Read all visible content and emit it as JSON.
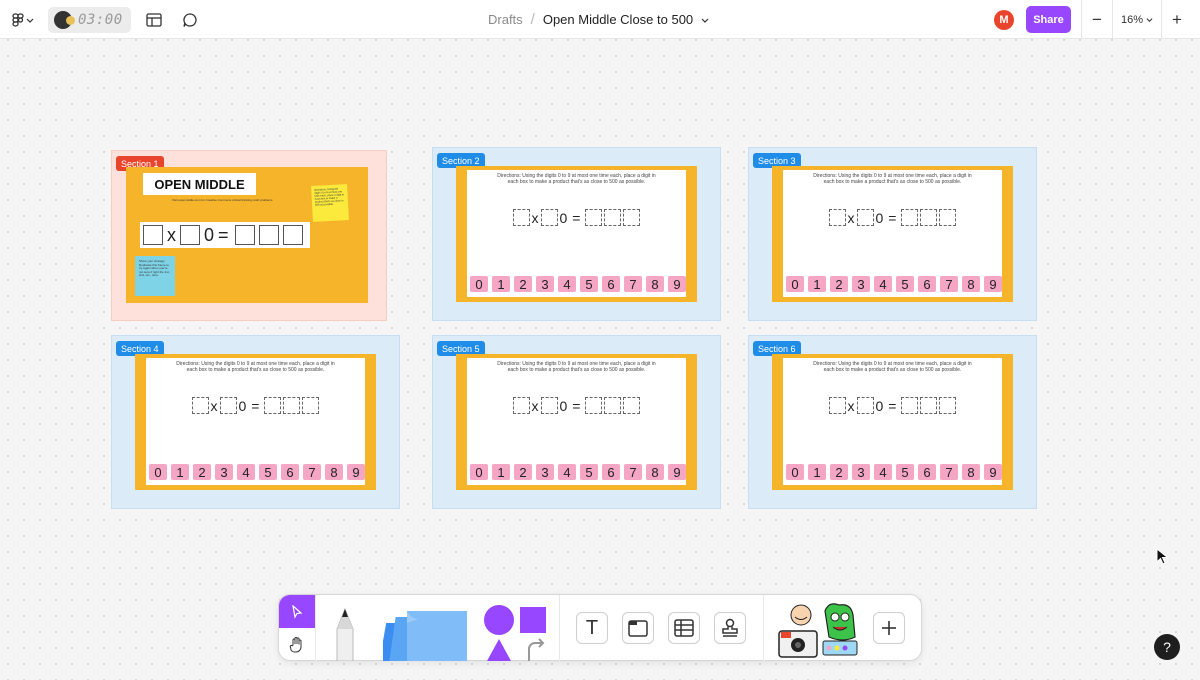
{
  "topbar": {
    "timer": "03:00",
    "breadcrumb_parent": "Drafts",
    "breadcrumb_sep": "/",
    "file_title": "Open Middle Close to 500",
    "avatar_initial": "M",
    "share_label": "Share",
    "zoom_minus": "−",
    "zoom_value": "16%",
    "zoom_plus": "+"
  },
  "colors": {
    "accent": "#9747ff",
    "section_pink": "#fde1da",
    "section_blue": "#dbebf8",
    "slide_orange": "#f6b42a",
    "digit_pink": "#f4a6c4"
  },
  "sections": [
    {
      "label": "Section 1"
    },
    {
      "label": "Section 2"
    },
    {
      "label": "Section 3"
    },
    {
      "label": "Section 4"
    },
    {
      "label": "Section 5"
    },
    {
      "label": "Section 6"
    }
  ],
  "slide": {
    "directions": "Directions: Using the digits 0 to 9 at most one time each, place a digit in each box to make a product that's as close to 500 as possible.",
    "times": "x",
    "zero": "0",
    "equals": "=",
    "digits": [
      "0",
      "1",
      "2",
      "3",
      "4",
      "5",
      "6",
      "7",
      "8",
      "9"
    ]
  },
  "section1": {
    "title": "OPEN MIDDLE",
    "subtitle": "Visit openmiddle.com for Creative Commons critical thinking math problems",
    "sticky_yellow": "Directions: Using the digits 0 to 9 at most one time each, place a digit in each box to make a product that's as close to 500 as possible.",
    "sticky_blue": "Show your strategy. Duplicate this frame to try again when you're not sure if right the 1st, 2nd, etc., time."
  },
  "toolbar": {
    "text_tool": "T",
    "icons": [
      "cursor-icon",
      "hand-icon",
      "pen-icon",
      "sticky-note-icon",
      "shapes-icon",
      "text-icon",
      "section-icon",
      "table-icon",
      "stamp-icon",
      "stickers-icon",
      "plus-icon"
    ]
  },
  "help_label": "?"
}
